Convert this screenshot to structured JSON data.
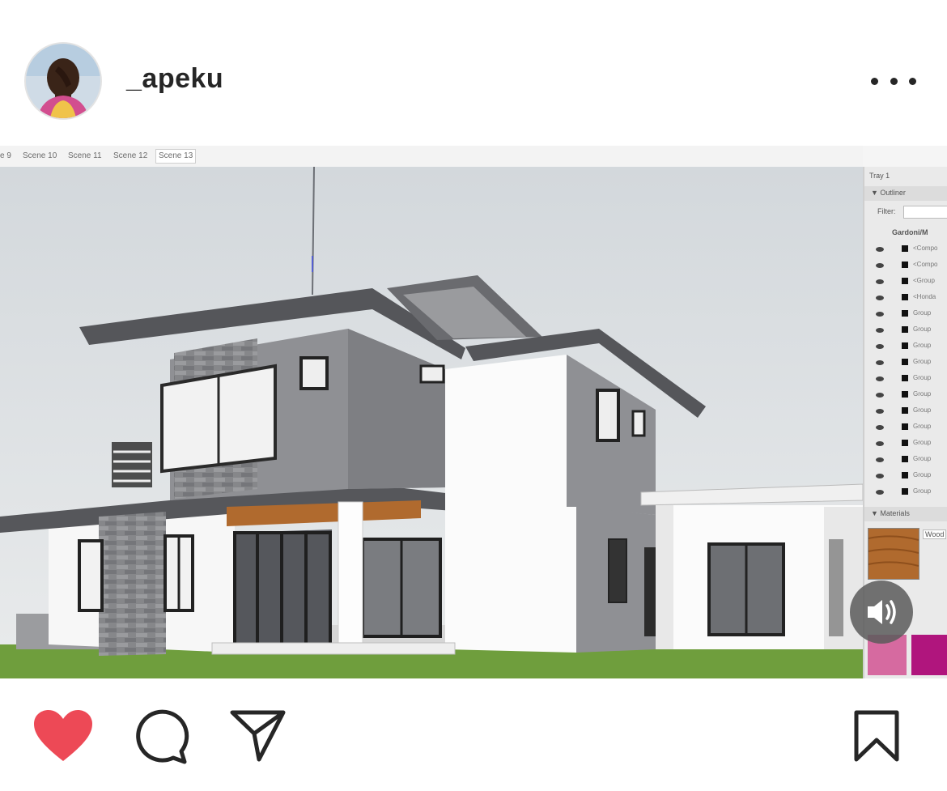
{
  "post": {
    "username": "_apeku",
    "more_options_icon": "ellipsis-icon"
  },
  "media": {
    "scene_tabs": [
      "e 9",
      "Scene 10",
      "Scene 11",
      "Scene 12",
      "Scene 13"
    ],
    "active_scene": "Scene 13",
    "tray": {
      "title": "Tray 1",
      "outliner_label": "▼ Outliner",
      "filter_label": "Filter:",
      "root_item": "Gardoni/M",
      "items": [
        "<Compo",
        "<Compo",
        "<Group",
        "<Honda",
        "Group",
        "Group",
        "Group",
        "Group",
        "Group",
        "Group",
        "Group",
        "Group",
        "Group",
        "Group",
        "Group",
        "Group"
      ],
      "materials_label": "▼ Materials",
      "material_name": "Wood"
    },
    "colors": {
      "sky": "#dfe3e6",
      "grass": "#6f9e3d",
      "roof": "#595a5e",
      "wall_gray": "#8f9094",
      "wall_white": "#fbfbfb",
      "stone": "#86878a",
      "wood": "#b06a2e",
      "swatch_pink": "#d66aa0",
      "swatch_magenta": "#b0157d"
    }
  },
  "actions": {
    "like_icon": "heart-icon",
    "comment_icon": "comment-icon",
    "share_icon": "paper-plane-icon",
    "save_icon": "bookmark-icon",
    "liked": true,
    "like_color": "#ed4956"
  },
  "video": {
    "sound_icon": "speaker-icon"
  }
}
